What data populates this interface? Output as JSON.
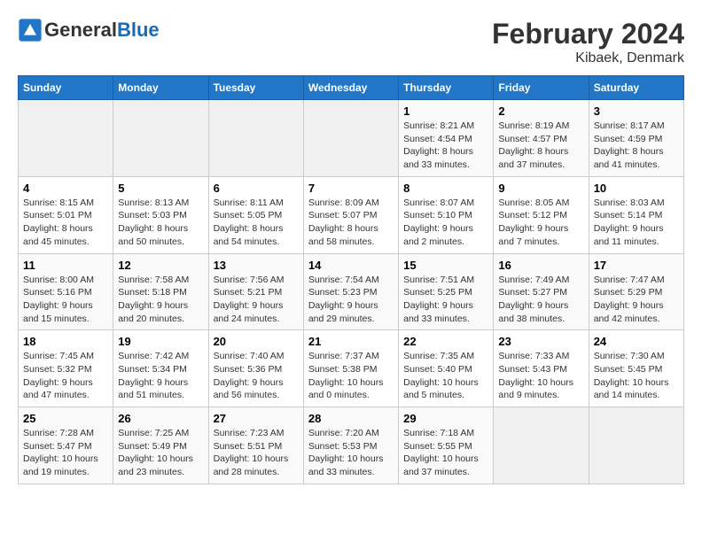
{
  "header": {
    "logo_general": "General",
    "logo_blue": "Blue",
    "title": "February 2024",
    "subtitle": "Kibaek, Denmark"
  },
  "days_of_week": [
    "Sunday",
    "Monday",
    "Tuesday",
    "Wednesday",
    "Thursday",
    "Friday",
    "Saturday"
  ],
  "weeks": [
    [
      {
        "day": "",
        "info": ""
      },
      {
        "day": "",
        "info": ""
      },
      {
        "day": "",
        "info": ""
      },
      {
        "day": "",
        "info": ""
      },
      {
        "day": "1",
        "info": "Sunrise: 8:21 AM\nSunset: 4:54 PM\nDaylight: 8 hours\nand 33 minutes."
      },
      {
        "day": "2",
        "info": "Sunrise: 8:19 AM\nSunset: 4:57 PM\nDaylight: 8 hours\nand 37 minutes."
      },
      {
        "day": "3",
        "info": "Sunrise: 8:17 AM\nSunset: 4:59 PM\nDaylight: 8 hours\nand 41 minutes."
      }
    ],
    [
      {
        "day": "4",
        "info": "Sunrise: 8:15 AM\nSunset: 5:01 PM\nDaylight: 8 hours\nand 45 minutes."
      },
      {
        "day": "5",
        "info": "Sunrise: 8:13 AM\nSunset: 5:03 PM\nDaylight: 8 hours\nand 50 minutes."
      },
      {
        "day": "6",
        "info": "Sunrise: 8:11 AM\nSunset: 5:05 PM\nDaylight: 8 hours\nand 54 minutes."
      },
      {
        "day": "7",
        "info": "Sunrise: 8:09 AM\nSunset: 5:07 PM\nDaylight: 8 hours\nand 58 minutes."
      },
      {
        "day": "8",
        "info": "Sunrise: 8:07 AM\nSunset: 5:10 PM\nDaylight: 9 hours\nand 2 minutes."
      },
      {
        "day": "9",
        "info": "Sunrise: 8:05 AM\nSunset: 5:12 PM\nDaylight: 9 hours\nand 7 minutes."
      },
      {
        "day": "10",
        "info": "Sunrise: 8:03 AM\nSunset: 5:14 PM\nDaylight: 9 hours\nand 11 minutes."
      }
    ],
    [
      {
        "day": "11",
        "info": "Sunrise: 8:00 AM\nSunset: 5:16 PM\nDaylight: 9 hours\nand 15 minutes."
      },
      {
        "day": "12",
        "info": "Sunrise: 7:58 AM\nSunset: 5:18 PM\nDaylight: 9 hours\nand 20 minutes."
      },
      {
        "day": "13",
        "info": "Sunrise: 7:56 AM\nSunset: 5:21 PM\nDaylight: 9 hours\nand 24 minutes."
      },
      {
        "day": "14",
        "info": "Sunrise: 7:54 AM\nSunset: 5:23 PM\nDaylight: 9 hours\nand 29 minutes."
      },
      {
        "day": "15",
        "info": "Sunrise: 7:51 AM\nSunset: 5:25 PM\nDaylight: 9 hours\nand 33 minutes."
      },
      {
        "day": "16",
        "info": "Sunrise: 7:49 AM\nSunset: 5:27 PM\nDaylight: 9 hours\nand 38 minutes."
      },
      {
        "day": "17",
        "info": "Sunrise: 7:47 AM\nSunset: 5:29 PM\nDaylight: 9 hours\nand 42 minutes."
      }
    ],
    [
      {
        "day": "18",
        "info": "Sunrise: 7:45 AM\nSunset: 5:32 PM\nDaylight: 9 hours\nand 47 minutes."
      },
      {
        "day": "19",
        "info": "Sunrise: 7:42 AM\nSunset: 5:34 PM\nDaylight: 9 hours\nand 51 minutes."
      },
      {
        "day": "20",
        "info": "Sunrise: 7:40 AM\nSunset: 5:36 PM\nDaylight: 9 hours\nand 56 minutes."
      },
      {
        "day": "21",
        "info": "Sunrise: 7:37 AM\nSunset: 5:38 PM\nDaylight: 10 hours\nand 0 minutes."
      },
      {
        "day": "22",
        "info": "Sunrise: 7:35 AM\nSunset: 5:40 PM\nDaylight: 10 hours\nand 5 minutes."
      },
      {
        "day": "23",
        "info": "Sunrise: 7:33 AM\nSunset: 5:43 PM\nDaylight: 10 hours\nand 9 minutes."
      },
      {
        "day": "24",
        "info": "Sunrise: 7:30 AM\nSunset: 5:45 PM\nDaylight: 10 hours\nand 14 minutes."
      }
    ],
    [
      {
        "day": "25",
        "info": "Sunrise: 7:28 AM\nSunset: 5:47 PM\nDaylight: 10 hours\nand 19 minutes."
      },
      {
        "day": "26",
        "info": "Sunrise: 7:25 AM\nSunset: 5:49 PM\nDaylight: 10 hours\nand 23 minutes."
      },
      {
        "day": "27",
        "info": "Sunrise: 7:23 AM\nSunset: 5:51 PM\nDaylight: 10 hours\nand 28 minutes."
      },
      {
        "day": "28",
        "info": "Sunrise: 7:20 AM\nSunset: 5:53 PM\nDaylight: 10 hours\nand 33 minutes."
      },
      {
        "day": "29",
        "info": "Sunrise: 7:18 AM\nSunset: 5:55 PM\nDaylight: 10 hours\nand 37 minutes."
      },
      {
        "day": "",
        "info": ""
      },
      {
        "day": "",
        "info": ""
      }
    ]
  ]
}
